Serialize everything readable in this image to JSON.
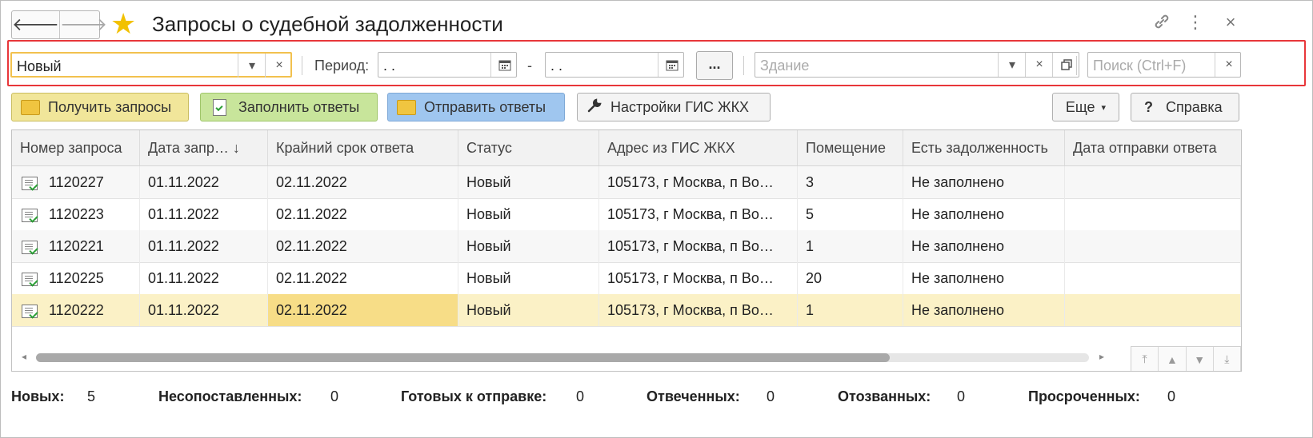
{
  "window": {
    "title": "Запросы о судебной задолженности"
  },
  "filter": {
    "status_value": "Новый",
    "period_label": "Период:",
    "date_from": " .  .",
    "date_to": " .  .",
    "dash": "-",
    "dots": "...",
    "building_placeholder": "Здание",
    "search_placeholder": "Поиск (Ctrl+F)"
  },
  "toolbar": {
    "get_requests": "Получить запросы",
    "fill_answers": "Заполнить ответы",
    "send_answers": "Отправить ответы",
    "gis_settings": "Настройки ГИС ЖКХ",
    "more": "Еще",
    "help": "Справка"
  },
  "table": {
    "columns": [
      "Номер запроса",
      "Дата запр… ↓",
      "Крайний срок ответа",
      "Статус",
      "Адрес из ГИС ЖКХ",
      "Помещение",
      "Есть задолженность",
      "Дата отправки ответа"
    ],
    "rows": [
      {
        "num": "1120227",
        "date": "01.11.2022",
        "deadline": "02.11.2022",
        "status": "Новый",
        "address": "105173, г Москва, п Во…",
        "room": "3",
        "debt": "Не заполнено",
        "sent": ""
      },
      {
        "num": "1120223",
        "date": "01.11.2022",
        "deadline": "02.11.2022",
        "status": "Новый",
        "address": "105173, г Москва, п Во…",
        "room": "5",
        "debt": "Не заполнено",
        "sent": ""
      },
      {
        "num": "1120221",
        "date": "01.11.2022",
        "deadline": "02.11.2022",
        "status": "Новый",
        "address": "105173, г Москва, п Во…",
        "room": "1",
        "debt": "Не заполнено",
        "sent": ""
      },
      {
        "num": "1120225",
        "date": "01.11.2022",
        "deadline": "02.11.2022",
        "status": "Новый",
        "address": "105173, г Москва, п Во…",
        "room": "20",
        "debt": "Не заполнено",
        "sent": ""
      },
      {
        "num": "1120222",
        "date": "01.11.2022",
        "deadline": "02.11.2022",
        "status": "Новый",
        "address": "105173, г Москва, п Во…",
        "room": "1",
        "debt": "Не заполнено",
        "sent": ""
      }
    ]
  },
  "summary": {
    "new_label": "Новых:",
    "new_value": "5",
    "unmatched_label": "Несопоставленных:",
    "unmatched_value": "0",
    "ready_label": "Готовых к отправке:",
    "ready_value": "0",
    "answered_label": "Отвеченных:",
    "answered_value": "0",
    "revoked_label": "Отозванных:",
    "revoked_value": "0",
    "overdue_label": "Просроченных:",
    "overdue_value": "0"
  },
  "colors": {
    "accent_yellow": "#f2c100",
    "highlight_red": "#e8363a",
    "selected_row": "#fbf1c6"
  }
}
